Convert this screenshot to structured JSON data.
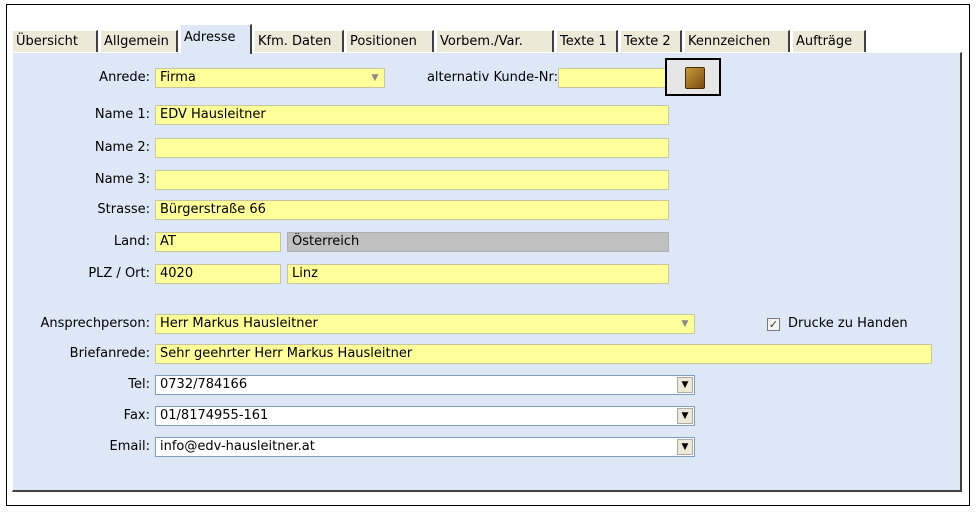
{
  "tabs": [
    "Übersicht",
    "Allgemein",
    "Adresse",
    "Kfm. Daten",
    "Positionen",
    "Vorbem./Var.",
    "Texte 1",
    "Texte 2",
    "Kennzeichen",
    "Aufträge"
  ],
  "active_tab": "Adresse",
  "form": {
    "anrede_label": "Anrede:",
    "anrede_value": "Firma",
    "alt_kunde_label": "alternativ Kunde-Nr:",
    "alt_kunde_value": "",
    "name1_label": "Name 1:",
    "name1_value": "EDV Hausleitner",
    "name2_label": "Name 2:",
    "name2_value": "",
    "name3_label": "Name 3:",
    "name3_value": "",
    "strasse_label": "Strasse:",
    "strasse_value": "Bürgerstraße 66",
    "land_label": "Land:",
    "land_code": "AT",
    "land_name": "Österreich",
    "plz_label": "PLZ / Ort:",
    "plz_value": "4020",
    "ort_value": "Linz",
    "ansprech_label": "Ansprechperson:",
    "ansprech_value": "Herr Markus Hausleitner",
    "drucke_label": "Drucke zu Handen",
    "brief_label": "Briefanrede:",
    "brief_value": "Sehr geehrter Herr Markus Hausleitner",
    "tel_label": "Tel:",
    "tel_value": "0732/784166",
    "fax_label": "Fax:",
    "fax_value": "01/8174955-161",
    "email_label": "Email:",
    "email_value": "info@edv-hausleitner.at"
  },
  "colors": {
    "panel": "#dde7f5",
    "field": "#ffff99",
    "readonly": "#c0c0c0"
  },
  "icons": {
    "combo_arrow": "chevron-down-icon",
    "picker": "book-icon",
    "checkbox": "check-icon"
  }
}
